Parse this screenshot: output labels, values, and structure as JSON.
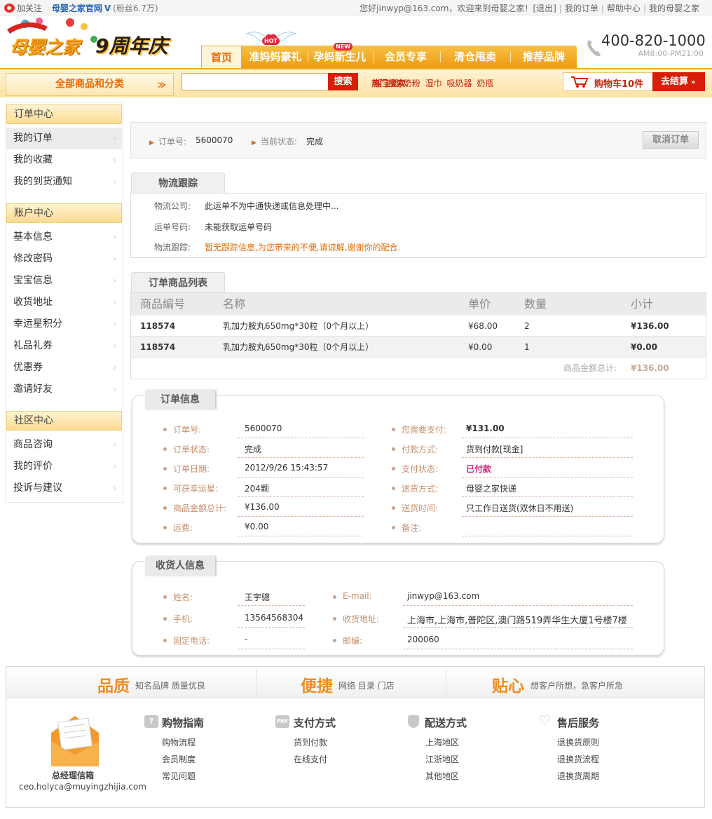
{
  "topbar": {
    "follow": "加关注",
    "official": "母婴之家官网",
    "fans": "(粉丝6.7万)",
    "greeting": "您好jinwyp@163.com，欢迎来到母婴之家！",
    "logout": "[退出]",
    "my_orders": "我的订单",
    "help": "帮助中心",
    "my_home": "我的母婴之家",
    "sep": "|"
  },
  "header": {
    "logo_text": "母婴之家",
    "anniversary": "9周年庆",
    "nav": [
      "首页",
      "准妈妈豪礼",
      "孕妈新生儿",
      "会员专享",
      "清仓甩卖",
      "推荐品牌"
    ],
    "hot_tag": "HOT",
    "new_tag": "NEW",
    "phone": "400-820-1000",
    "hours": "AM8:00-PM21:00"
  },
  "searchbar": {
    "category": "全部商品和分类",
    "search_value": "",
    "search_btn": "搜索",
    "hot_label": "热门搜索：",
    "hot_keywords": [
      "帮宝适",
      "奶粉",
      "湿巾",
      "吸奶器",
      "奶瓶"
    ],
    "cart": "购物车10件",
    "checkout": "去结算"
  },
  "sidebar": {
    "order_center": "订单中心",
    "order_items": [
      "我的订单",
      "我的收藏",
      "我的到货通知"
    ],
    "account_center": "账户中心",
    "account_items": [
      "基本信息",
      "修改密码",
      "宝宝信息",
      "收货地址",
      "幸运星积分",
      "礼品礼券",
      "优惠券",
      "邀请好友"
    ],
    "community_center": "社区中心",
    "community_items": [
      "商品咨询",
      "我的评价",
      "投诉与建议"
    ],
    "arrow": "›"
  },
  "order": {
    "no_label": "订单号:",
    "no": "5600070",
    "status_label": "当前状态:",
    "status": "完成",
    "cancel": "取消订单"
  },
  "logistics": {
    "title": "物流跟踪",
    "company_label": "物流公司:",
    "company": "此运单不为中通快递或信息处理中...",
    "waybill_label": "运单号码:",
    "waybill": "未能获取运单号码",
    "track_label": "物流跟踪:",
    "track": "暂无跟踪信息,为您带来的不便,请谅解,谢谢你的配合."
  },
  "products": {
    "title": "订单商品列表",
    "headers": [
      "商品编号",
      "名称",
      "单价",
      "数量",
      "小计"
    ],
    "rows": [
      {
        "id": "118574",
        "name": "乳加力胺丸650mg*30粒（0个月以上）",
        "price": "¥68.00",
        "qty": "2",
        "subtotal": "¥136.00"
      },
      {
        "id": "118574",
        "name": "乳加力胺丸650mg*30粒（0个月以上）",
        "price": "¥0.00",
        "qty": "1",
        "subtotal": "¥0.00"
      }
    ],
    "total_label": "商品金额总计:",
    "total": "¥136.00"
  },
  "order_info": {
    "title": "订单信息",
    "left": [
      {
        "label": "订单号:",
        "value": "5600070"
      },
      {
        "label": "订单状态:",
        "value": "完成"
      },
      {
        "label": "订单日期:",
        "value": "2012/9/26 15:43:57"
      },
      {
        "label": "可获幸运星:",
        "value": "204颗"
      },
      {
        "label": "商品金额总计:",
        "value": "¥136.00"
      },
      {
        "label": "运费:",
        "value": "¥0.00"
      }
    ],
    "right": [
      {
        "label": "您需要支付:",
        "value": "¥131.00"
      },
      {
        "label": "付款方式:",
        "value": "货到付款[现金]"
      },
      {
        "label": "支付状态:",
        "value": "已付款"
      },
      {
        "label": "送货方式:",
        "value": "母婴之家快递"
      },
      {
        "label": "送货时间:",
        "value": "只工作日送货(双休日不用送)"
      },
      {
        "label": "备注:",
        "value": ""
      }
    ]
  },
  "receiver": {
    "title": "收货人信息",
    "left": [
      {
        "label": "姓名:",
        "value": "王宇骢"
      },
      {
        "label": "手机:",
        "value": "13564568304"
      },
      {
        "label": "固定电话:",
        "value": "-"
      }
    ],
    "right": [
      {
        "label": "E-mail:",
        "value": "jinwyp@163.com"
      },
      {
        "label": "收货地址:",
        "value": "上海市,上海市,普陀区,澳门路519弄华生大厦1号楼7楼"
      },
      {
        "label": "邮编:",
        "value": "200060"
      }
    ]
  },
  "footer": {
    "features": [
      {
        "big": "品质",
        "small": "知名品牌  质量优良"
      },
      {
        "big": "便捷",
        "small": "网络  目录  门店"
      },
      {
        "big": "贴心",
        "small": "想客户所想，急客户所急"
      }
    ],
    "mailbox_title": "总经理信箱",
    "mailbox_email": "ceo.holyca@muyingzhijia.com",
    "columns": [
      {
        "title": "购物指南",
        "links": [
          "购物流程",
          "会员制度",
          "常见问题"
        ]
      },
      {
        "title": "支付方式",
        "links": [
          "货到付款",
          "在线支付"
        ]
      },
      {
        "title": "配送方式",
        "links": [
          "上海地区",
          "江浙地区",
          "其他地区"
        ]
      },
      {
        "title": "售后服务",
        "links": [
          "退换货原则",
          "退换货流程",
          "退换货周期"
        ]
      }
    ]
  },
  "colors": {
    "accent": "#ee9b11",
    "brand_red": "#d81e06",
    "label_brown": "#c6906d",
    "paid_magenta": "#cc2a7a"
  }
}
